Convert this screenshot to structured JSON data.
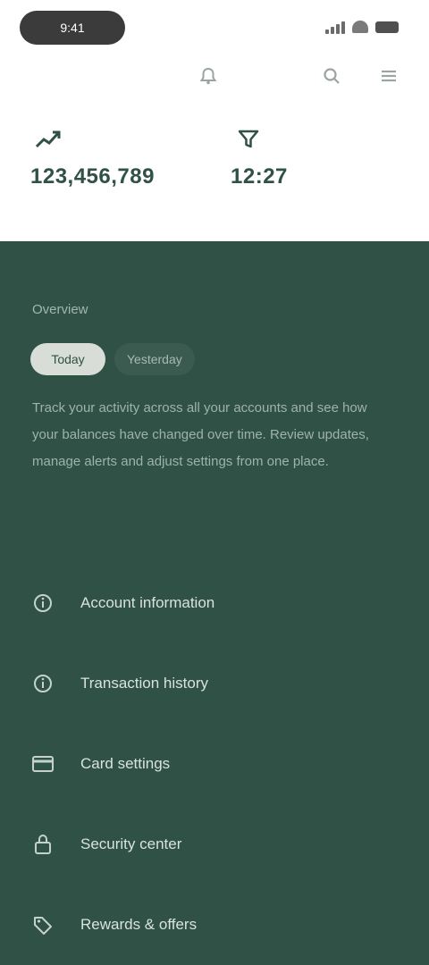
{
  "status_bar": {
    "time": "9:41"
  },
  "nav": {
    "icons": [
      "bell-icon",
      "search-icon",
      "menu-icon"
    ]
  },
  "stats": [
    {
      "icon": "trend-icon",
      "caption": "",
      "value": "123,456,789"
    },
    {
      "icon": "filter-icon",
      "caption": "",
      "value": "12:27"
    }
  ],
  "section": {
    "title": "Overview",
    "tabs": [
      {
        "label": "Today",
        "active": true
      },
      {
        "label": "Yesterday",
        "active": false
      }
    ],
    "description": "Track your activity across all your accounts and see how your balances have changed over time. Review updates, manage alerts and adjust settings from one place."
  },
  "actions": [
    {
      "icon": "info-icon",
      "label": "Account information"
    },
    {
      "icon": "info-icon",
      "label": "Transaction history"
    },
    {
      "icon": "card-icon",
      "label": "Card settings"
    },
    {
      "icon": "lock-icon",
      "label": "Security center"
    },
    {
      "icon": "tag-icon",
      "label": "Rewards & offers"
    }
  ],
  "colors": {
    "primary": "#2f5146",
    "surface": "#ffffff"
  }
}
